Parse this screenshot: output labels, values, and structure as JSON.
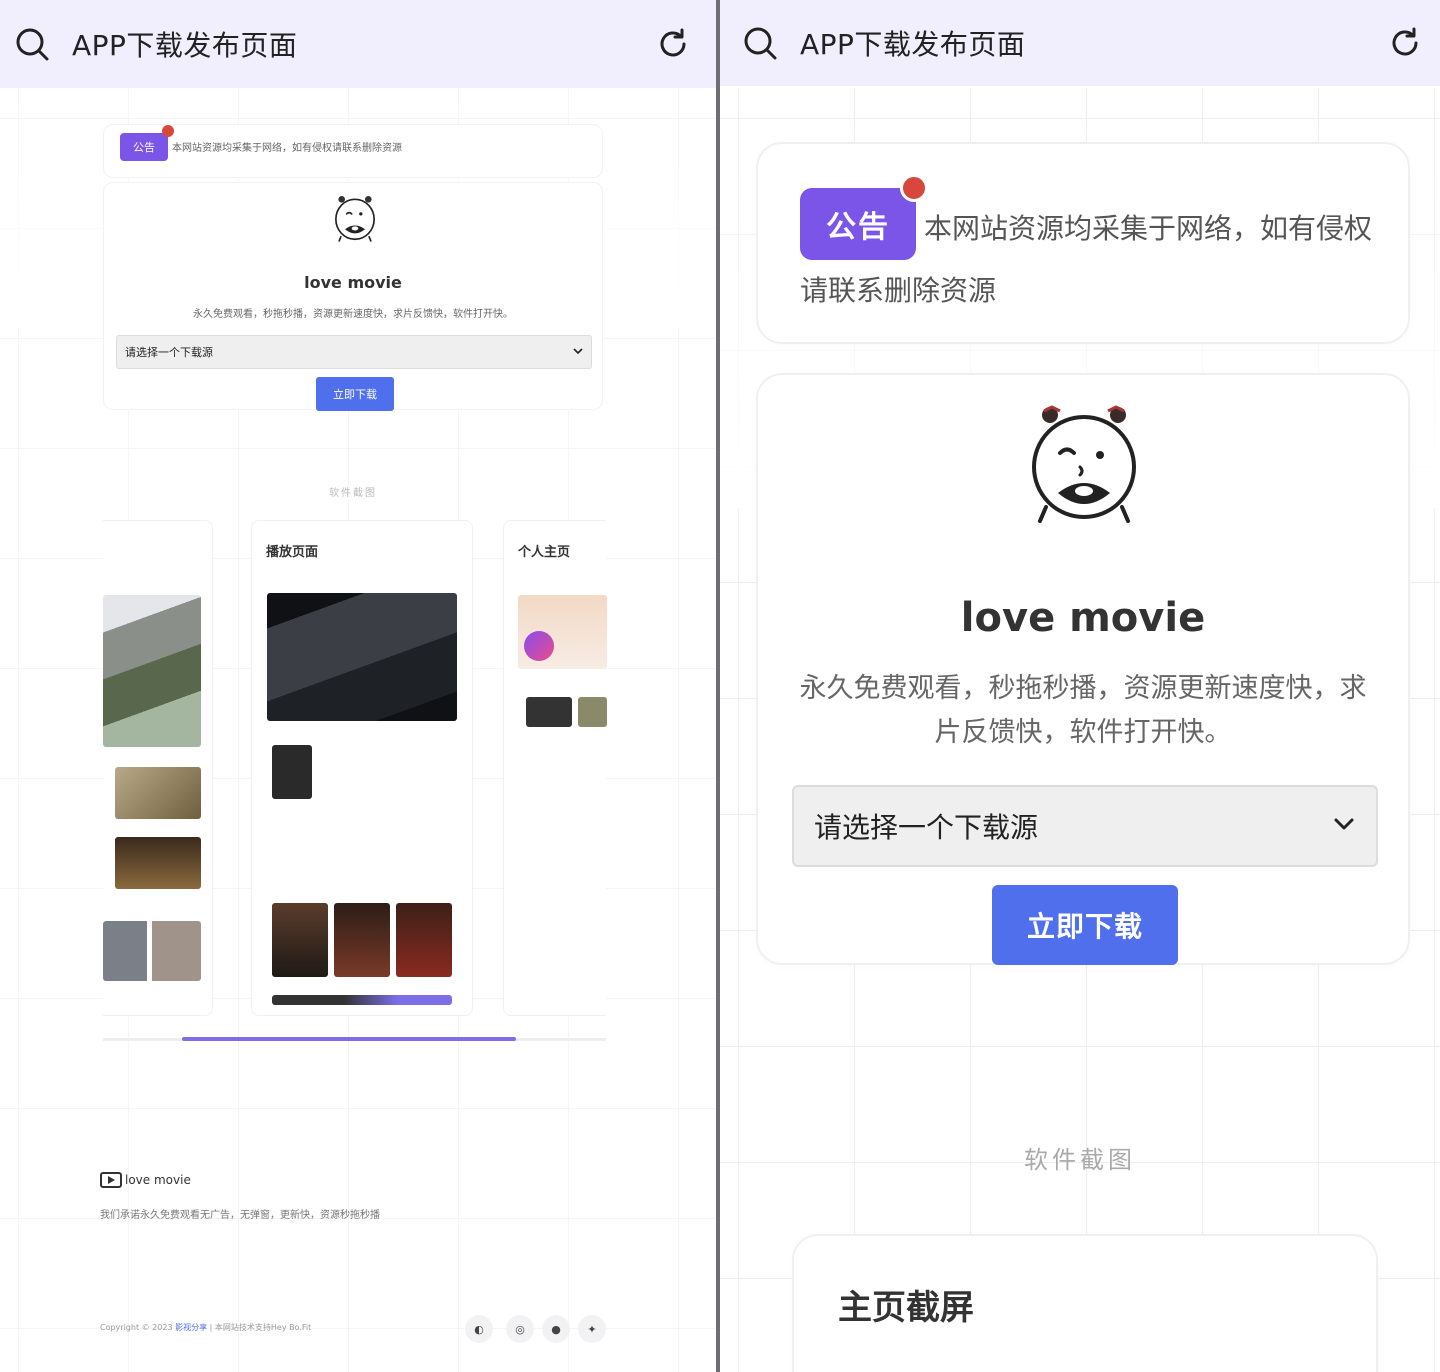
{
  "left": {
    "header": {
      "title": "APP下载发布页面"
    },
    "notice": {
      "badge": "公告",
      "text": "本网站资源均采集于网络，如有侵权请联系删除资源"
    },
    "app": {
      "name": "love movie",
      "description": "永久免费观看，秒拖秒播，资源更新速度快，求片反馈快，软件打开快。",
      "select_placeholder": "请选择一个下载源",
      "download_label": "立即下载"
    },
    "screenshots": {
      "section_title": "软件截图",
      "cards": [
        {
          "title": ""
        },
        {
          "title": "播放页面"
        },
        {
          "title": "个人主页"
        }
      ]
    },
    "footer": {
      "brand": "love movie",
      "description": "我们承诺永久免费观看无广告，无弹窗，更新快，资源秒拖秒播",
      "copyright_prefix": "Copyright © 2023",
      "copyright_link": "影视分享",
      "copyright_suffix": "| 本网站技术支持Hey Bo.Fit"
    }
  },
  "right": {
    "header": {
      "title": "APP下载发布页面"
    },
    "notice": {
      "badge": "公告",
      "text": "本网站资源均采集于网络，如有侵权请联系删除资源"
    },
    "app": {
      "name": "love movie",
      "description": "永久免费观看，秒拖秒播，资源更新速度快，求片反馈快，软件打开快。",
      "select_placeholder": "请选择一个下载源",
      "download_label": "立即下载"
    },
    "screenshots": {
      "section_title": "软件截图",
      "first_card_title": "主页截屏"
    }
  },
  "colors": {
    "header_bg": "#f1effd",
    "accent_purple": "#7b55e8",
    "notice_dot": "#d8473c",
    "button_blue": "#4f6fec",
    "scroll_thumb": "#7d6ee8"
  },
  "icons": {
    "header_left": "search-icon",
    "header_right": "refresh-icon",
    "select": "chevron-down-icon",
    "footer_social": [
      "theme-icon",
      "instagram-icon",
      "github-icon",
      "twitter-icon"
    ]
  }
}
